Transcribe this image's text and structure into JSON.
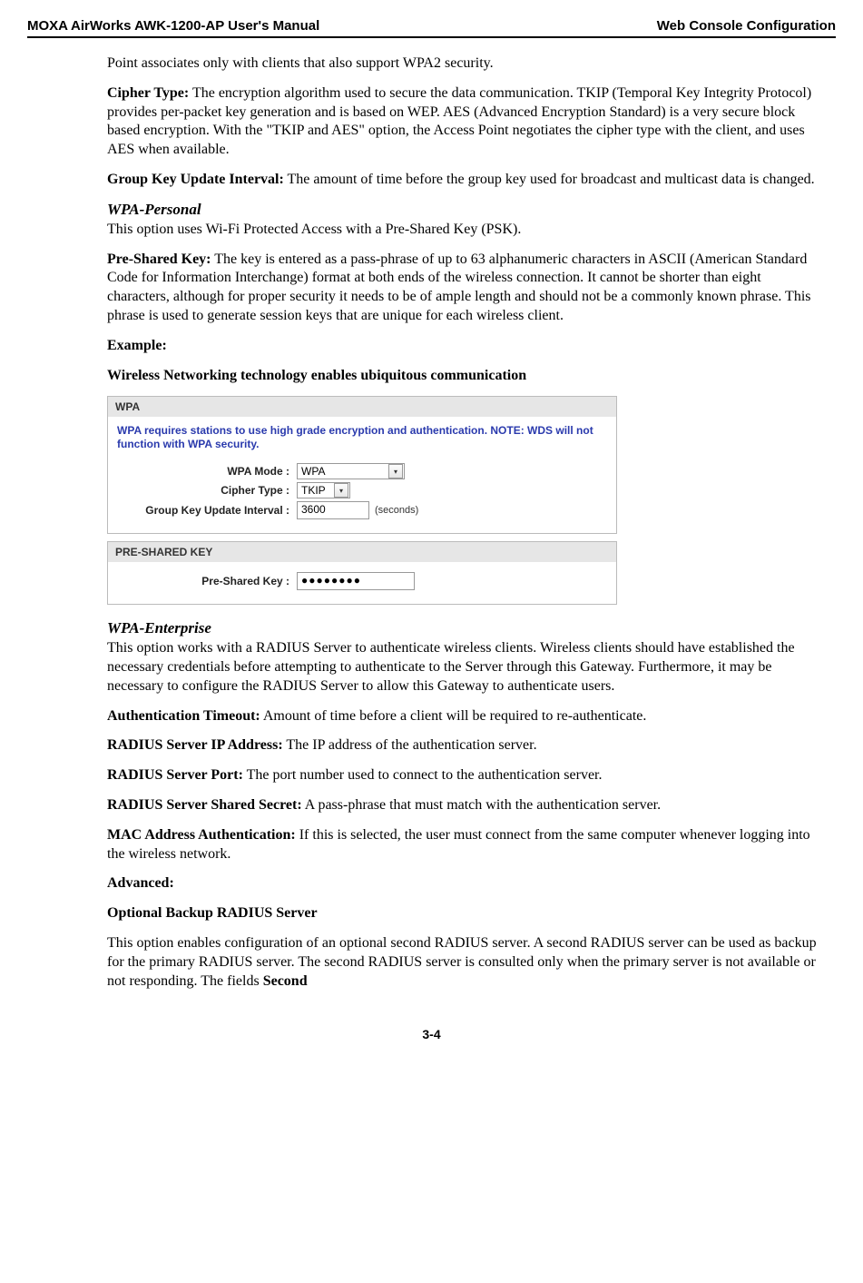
{
  "header": {
    "left": "MOXA AirWorks AWK-1200-AP User's Manual",
    "right": "Web Console Configuration"
  },
  "doc": {
    "p_intro": "Point associates only with clients that also support WPA2 security.",
    "cipher_label": "Cipher Type:",
    "cipher_text": " The encryption algorithm used to secure the data communication. TKIP (Temporal Key Integrity Protocol) provides per-packet key generation and is based on WEP. AES (Advanced Encryption Standard) is a very secure block based encryption. With the \"TKIP and AES\" option, the Access Point negotiates the cipher type with the client, and uses AES when available.",
    "gkui_label": "Group Key Update Interval:",
    "gkui_text": " The amount of time before the group key used for broadcast and multicast data is changed.",
    "wpa_personal_head": "WPA-Personal",
    "wpa_personal_intro": "This option uses Wi-Fi Protected Access with a Pre-Shared Key (PSK).",
    "psk_label": "Pre-Shared Key:",
    "psk_text": " The key is entered as a pass-phrase of up to 63 alphanumeric characters in ASCII (American Standard Code for Information Interchange) format at both ends of the wireless connection. It cannot be shorter than eight characters, although for proper security it needs to be of ample length and should not be a commonly known phrase. This phrase is used to generate session keys that are unique for each wireless client.",
    "example_label": "Example:",
    "example_phrase": "Wireless Networking technology enables ubiquitous communication",
    "wpa_enterprise_head": "WPA-Enterprise",
    "wpa_enterprise_intro": "This option works with a RADIUS Server to authenticate wireless clients. Wireless clients should have established the necessary credentials before attempting to authenticate to the Server through this Gateway. Furthermore, it may be necessary to configure the RADIUS Server to allow this Gateway to authenticate users.",
    "auth_timeout_label": "Authentication Timeout:",
    "auth_timeout_text": " Amount of time before a client will be required to re-authenticate.",
    "radius_ip_label": "RADIUS Server IP Address:",
    "radius_ip_text": " The IP address of the authentication server.",
    "radius_port_label": "RADIUS Server Port:",
    "radius_port_text": " The port number used to connect to the authentication server.",
    "radius_secret_label": "RADIUS Server Shared Secret:",
    "radius_secret_text": " A pass-phrase that must match with the authentication server.",
    "mac_auth_label": "MAC Address Authentication:",
    "mac_auth_text": " If this is selected, the user must connect from the same computer whenever logging into the wireless network.",
    "advanced_label": "Advanced:",
    "backup_radius_head": "Optional Backup RADIUS Server",
    "backup_radius_text_a": "This option enables configuration of an optional second RADIUS server. A second RADIUS server can be used as backup for the primary RADIUS server. The second RADIUS server is consulted only when the primary server is not available or not responding. The fields ",
    "backup_radius_second": "Second"
  },
  "screenshot": {
    "wpa_title": "WPA",
    "wpa_note": "WPA requires stations to use high grade encryption and authentication. NOTE: WDS will not function with WPA security.",
    "row_mode_label": "WPA Mode :",
    "row_mode_value": "WPA",
    "row_cipher_label": "Cipher Type :",
    "row_cipher_value": "TKIP",
    "row_gkui_label": "Group Key Update Interval :",
    "row_gkui_value": "3600",
    "row_gkui_suffix": "(seconds)",
    "psk_title": "PRE-SHARED KEY",
    "psk_row_label": "Pre-Shared Key :",
    "psk_row_value": "●●●●●●●●"
  },
  "footer": {
    "page_num": "3-4"
  }
}
